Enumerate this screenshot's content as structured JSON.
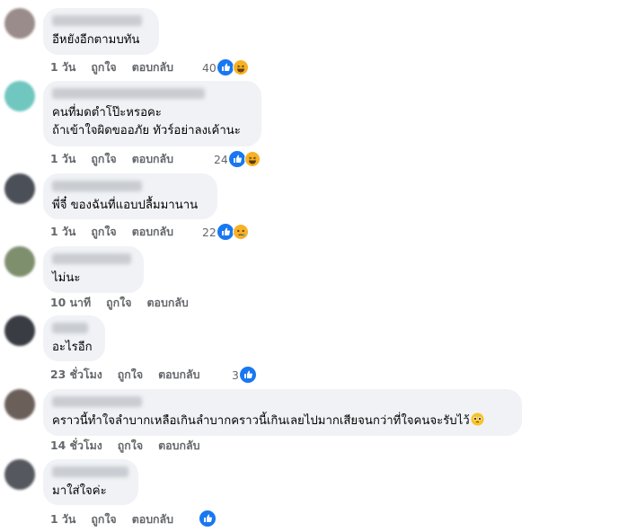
{
  "comments": [
    {
      "text": "อีหยังอีกตามบทัน",
      "time": "1 วัน",
      "like": "ถูกใจ",
      "reply": "ตอบกลับ",
      "count": "40",
      "reactions": [
        "like-icon",
        "haha-icon"
      ],
      "avatar_color": "#9a8c8a"
    },
    {
      "text": "คนที่มดตำโป๊ะหรอคะ\nถ้าเข้าใจผิดขออภัย ทัวร์อย่าลงเค้านะ",
      "time": "1 วัน",
      "like": "ถูกใจ",
      "reply": "ตอบกลับ",
      "count": "24",
      "reactions": [
        "like-icon",
        "haha-icon"
      ],
      "avatar_color": "#6fc7c0"
    },
    {
      "text": "พี่จี๋ ของฉันที่แอบปลื้มมานาน",
      "time": "1 วัน",
      "like": "ถูกใจ",
      "reply": "ตอบกลับ",
      "count": "22",
      "reactions": [
        "like-icon",
        "sad-icon"
      ],
      "avatar_color": "#4a4f58"
    },
    {
      "text": "ไม่นะ",
      "time": "10 นาที",
      "like": "ถูกใจ",
      "reply": "ตอบกลับ",
      "count": "",
      "reactions": [],
      "avatar_color": "#7e8f6e"
    },
    {
      "text": "อะไรอีก",
      "time": "23 ชั่วโมง",
      "like": "ถูกใจ",
      "reply": "ตอบกลับ",
      "count": "3",
      "reactions": [
        "like-icon"
      ],
      "avatar_color": "#3a3c44"
    },
    {
      "text": "คราวนี้ทำใจลำบากเหลือเกินลำบากคราวนี้เกินเลยไปมากเสียจนกว่าที่ใจคนจะรับไว้",
      "time": "14 ชั่วโมง",
      "like": "ถูกใจ",
      "reply": "ตอบกลับ",
      "count": "",
      "reactions": [],
      "avatar_color": "#6b5f5a",
      "inline_emoji": "pleading-face-icon"
    },
    {
      "text": "มาใส่ใจค่ะ",
      "time": "1 วัน",
      "like": "ถูกใจ",
      "reply": "ตอบกลับ",
      "count": "",
      "reactions": [
        "like-icon"
      ],
      "avatar_color": "#55585e"
    }
  ],
  "colors": {
    "like_blue": "#1877f2",
    "haha_yellow": "#f7b125",
    "text_gray": "#65676b",
    "bubble_bg": "#f0f2f5"
  }
}
